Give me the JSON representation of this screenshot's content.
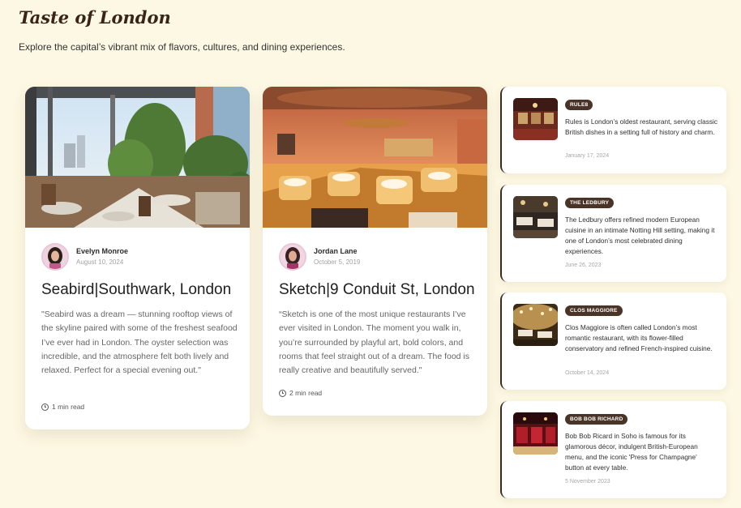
{
  "header": {
    "title": "Taste of London",
    "subtitle": "Explore the capital’s vibrant mix of flavors, cultures, and dining experiences."
  },
  "featured": [
    {
      "image_icon": "rooftop-terrace-photo",
      "author": "Evelyn Monroe",
      "date": "August 10, 2024",
      "title": "Seabird|Southwark, London",
      "quote": "\"Seabird was a dream — stunning rooftop views of the skyline paired with some of the freshest seafood I’ve ever had in London. The oyster selection was incredible, and the atmosphere felt both lively and relaxed. Perfect for a special evening out.\"",
      "read_time": "1 min read"
    },
    {
      "image_icon": "pink-dining-room-photo",
      "author": "Jordan Lane",
      "date": "October 5, 2019",
      "title": "Sketch|9 Conduit St, London",
      "quote": "“Sketch is one of the most unique restaurants I’ve ever visited in London. The moment you walk in, you’re surrounded by playful art, bold colors, and rooms that feel straight out of a dream. The food is really creative and beautifully served.\"",
      "read_time": "2 min read"
    }
  ],
  "restaurants": [
    {
      "badge": "RULE8",
      "text": "Rules is London’s oldest restaurant, serving classic British dishes in a setting full of history and charm.",
      "date": "January 17, 2024"
    },
    {
      "badge": "THE LEDBURY",
      "text": "The Ledbury offers refined modern European cuisine in an intimate Notting Hill setting, making it one of London’s most celebrated dining experiences.",
      "date": "June 26, 2023"
    },
    {
      "badge": "CLOS MAGGIORE",
      "text": "Clos Maggiore is often called London’s most romantic restaurant, with its flower-filled conservatory and refined French-inspired cuisine.",
      "date": "October 14, 2024"
    },
    {
      "badge": "BOB BOB RICHARD",
      "text": "Bob Bob Ricard in Soho is famous for its glamorous décor, indulgent British-European menu, and the iconic 'Press for Champagne' button at every table.",
      "date": "5 November 2023"
    }
  ],
  "colors": {
    "background": "#fdf8e3",
    "badge": "#4a3427",
    "accent_border": "#3b2a22"
  }
}
